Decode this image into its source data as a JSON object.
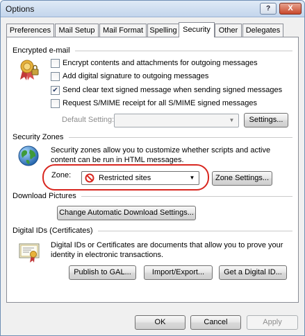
{
  "window": {
    "title": "Options",
    "help_label": "?",
    "close_label": "X"
  },
  "tabs": [
    {
      "label": "Preferences",
      "active": false
    },
    {
      "label": "Mail Setup",
      "active": false
    },
    {
      "label": "Mail Format",
      "active": false
    },
    {
      "label": "Spelling",
      "active": false
    },
    {
      "label": "Security",
      "active": true
    },
    {
      "label": "Other",
      "active": false
    },
    {
      "label": "Delegates",
      "active": false
    }
  ],
  "encrypted_email": {
    "heading": "Encrypted e-mail",
    "options": [
      {
        "label": "Encrypt contents and attachments for outgoing messages",
        "checked": false
      },
      {
        "label": "Add digital signature to outgoing messages",
        "checked": false
      },
      {
        "label": "Send clear text signed message when sending signed messages",
        "checked": true
      },
      {
        "label": "Request S/MIME receipt for all S/MIME signed messages",
        "checked": false
      }
    ],
    "default_setting_label": "Default Setting:",
    "default_setting_value": "",
    "settings_button": "Settings..."
  },
  "security_zones": {
    "heading": "Security Zones",
    "description": "Security zones allow you to customize whether scripts and active content can be run in HTML messages.",
    "zone_label": "Zone:",
    "zone_value": "Restricted sites",
    "zone_settings_button": "Zone Settings..."
  },
  "download_pictures": {
    "heading": "Download Pictures",
    "button": "Change Automatic Download Settings..."
  },
  "digital_ids": {
    "heading": "Digital IDs (Certificates)",
    "description": "Digital IDs or Certificates are documents that allow you to prove your identity in electronic transactions.",
    "publish_button": "Publish to GAL...",
    "import_export_button": "Import/Export...",
    "get_id_button": "Get a Digital ID..."
  },
  "footer": {
    "ok": "OK",
    "cancel": "Cancel",
    "apply": "Apply"
  },
  "colors": {
    "highlight_ring": "#d8261f",
    "restricted_icon": "#d8261f"
  }
}
